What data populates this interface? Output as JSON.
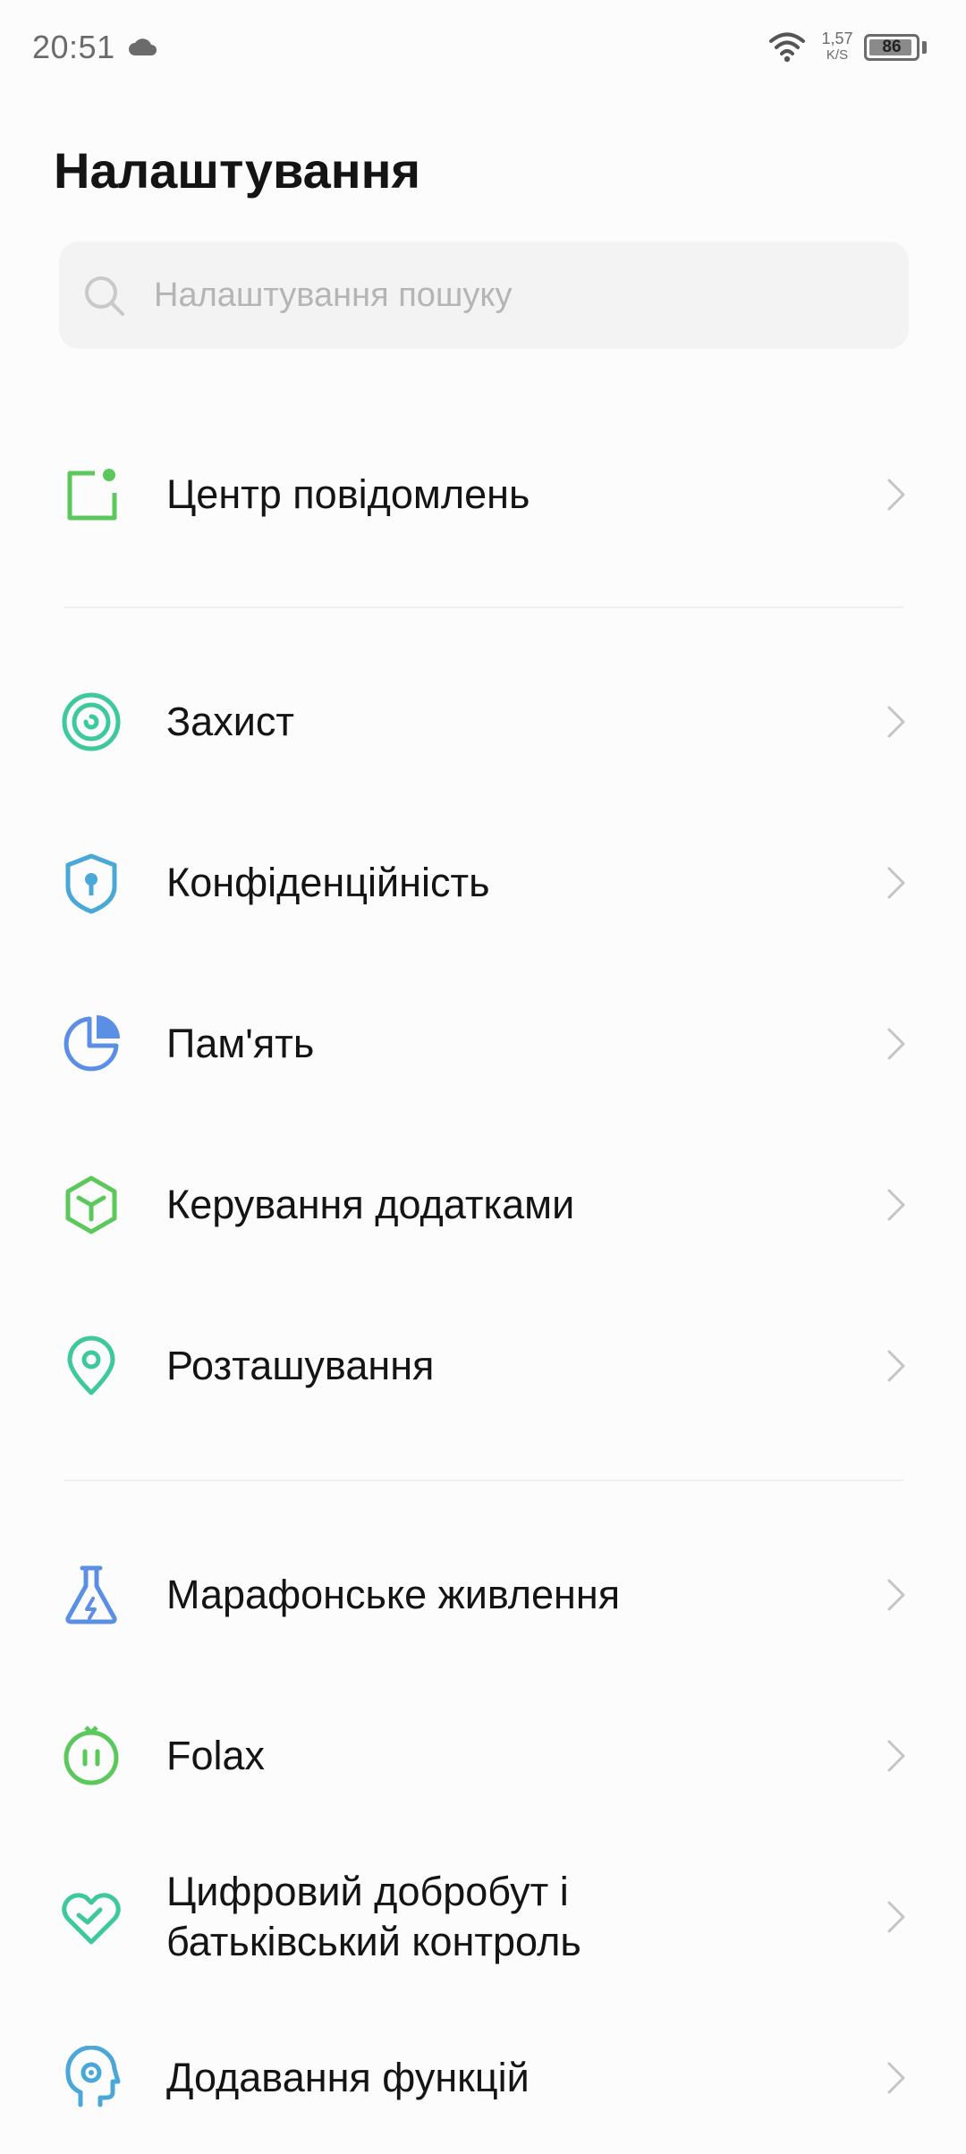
{
  "status_bar": {
    "time": "20:51",
    "net_speed": "1,57",
    "net_unit": "K/S",
    "battery": "86"
  },
  "header": {
    "title": "Налаштування"
  },
  "search": {
    "placeholder": "Налаштування пошуку"
  },
  "colors": {
    "green": "#5ac85a",
    "teal": "#3ec99a",
    "blue": "#4aa8d8",
    "periwinkle": "#5b8fe6",
    "chevron": "#c4c4c4"
  },
  "items": [
    {
      "label": "Центр повідомлень",
      "icon": "notification-center-icon"
    },
    {
      "label": "Захист",
      "icon": "security-icon"
    },
    {
      "label": "Конфіденційність",
      "icon": "privacy-shield-icon"
    },
    {
      "label": "Пам'ять",
      "icon": "storage-pie-icon"
    },
    {
      "label": "Керування додатками",
      "icon": "app-management-icon"
    },
    {
      "label": "Розташування",
      "icon": "location-pin-icon"
    },
    {
      "label": "Марафонське живлення",
      "icon": "marathon-power-flask-icon"
    },
    {
      "label": "Folax",
      "icon": "folax-icon"
    },
    {
      "label": "Цифровий добробут і",
      "label_line2": "батьківський контроль",
      "icon": "digital-wellbeing-heart-icon"
    },
    {
      "label": "Додавання функцій",
      "icon": "feature-add-head-icon"
    }
  ]
}
